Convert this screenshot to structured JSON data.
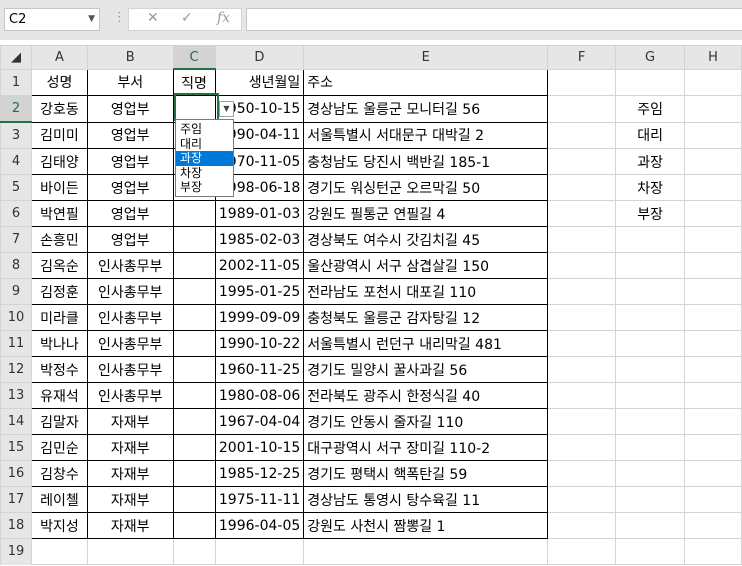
{
  "formula_bar": {
    "name_box": "C2",
    "cancel_icon": "✕",
    "enter_icon": "✓",
    "fx_icon": "fx",
    "formula": ""
  },
  "columns": [
    "A",
    "B",
    "C",
    "D",
    "E",
    "F",
    "G",
    "H"
  ],
  "selected_column": "C",
  "selected_row": 2,
  "rows": [
    {
      "n": "1",
      "a": "성명",
      "b": "부서",
      "c": "직명",
      "d": "생년월일",
      "e": "주소",
      "g": ""
    },
    {
      "n": "2",
      "a": "강호동",
      "b": "영업부",
      "c": "",
      "d": "1950-10-15",
      "e": "경상남도 울릉군 모니터길 56",
      "g": "주임"
    },
    {
      "n": "3",
      "a": "김미미",
      "b": "영업부",
      "c": "",
      "d": "1990-04-11",
      "e": "서울특별시 서대문구 대박길 2",
      "g": "대리"
    },
    {
      "n": "4",
      "a": "김태양",
      "b": "영업부",
      "c": "",
      "d": "1970-11-05",
      "e": "충청남도 당진시 백반길 185-1",
      "g": "과장"
    },
    {
      "n": "5",
      "a": "바이든",
      "b": "영업부",
      "c": "",
      "d": "1998-06-18",
      "e": "경기도 워싱턴군 오르막길 50",
      "g": "차장"
    },
    {
      "n": "6",
      "a": "박연필",
      "b": "영업부",
      "c": "",
      "d": "1989-01-03",
      "e": "강원도 필통군 연필길 4",
      "g": "부장"
    },
    {
      "n": "7",
      "a": "손흥민",
      "b": "영업부",
      "c": "",
      "d": "1985-02-03",
      "e": "경상북도 여수시 갓김치길 45",
      "g": ""
    },
    {
      "n": "8",
      "a": "김옥순",
      "b": "인사총무부",
      "c": "",
      "d": "2002-11-05",
      "e": "울산광역시 서구 삼겹살길 150",
      "g": ""
    },
    {
      "n": "9",
      "a": "김정훈",
      "b": "인사총무부",
      "c": "",
      "d": "1995-01-25",
      "e": "전라남도 포천시 대포길 110",
      "g": ""
    },
    {
      "n": "10",
      "a": "미라클",
      "b": "인사총무부",
      "c": "",
      "d": "1999-09-09",
      "e": "충청북도 울릉군 감자탕길 12",
      "g": ""
    },
    {
      "n": "11",
      "a": "박나나",
      "b": "인사총무부",
      "c": "",
      "d": "1990-10-22",
      "e": "서울특별시 런던구 내리막길 481",
      "g": ""
    },
    {
      "n": "12",
      "a": "박정수",
      "b": "인사총무부",
      "c": "",
      "d": "1960-11-25",
      "e": "경기도 밀양시 꿀사과길 56",
      "g": ""
    },
    {
      "n": "13",
      "a": "유재석",
      "b": "인사총무부",
      "c": "",
      "d": "1980-08-06",
      "e": "전라북도 광주시 한정식길 40",
      "g": ""
    },
    {
      "n": "14",
      "a": "김말자",
      "b": "자재부",
      "c": "",
      "d": "1967-04-04",
      "e": "경기도 안동시 줄자길 110",
      "g": ""
    },
    {
      "n": "15",
      "a": "김민순",
      "b": "자재부",
      "c": "",
      "d": "2001-10-15",
      "e": "대구광역시 서구 장미길 110-2",
      "g": ""
    },
    {
      "n": "16",
      "a": "김창수",
      "b": "자재부",
      "c": "",
      "d": "1985-12-25",
      "e": "경기도 평택시 핵폭탄길 59",
      "g": ""
    },
    {
      "n": "17",
      "a": "레이첼",
      "b": "자재부",
      "c": "",
      "d": "1975-11-11",
      "e": "경상남도 통영시 탕수육길 11",
      "g": ""
    },
    {
      "n": "18",
      "a": "박지성",
      "b": "자재부",
      "c": "",
      "d": "1996-04-05",
      "e": "강원도 사천시 짬뽕길 1",
      "g": ""
    },
    {
      "n": "19",
      "a": "",
      "b": "",
      "c": "",
      "d": "",
      "e": "",
      "g": ""
    }
  ],
  "dropdown": {
    "items": [
      "주임",
      "대리",
      "과장",
      "차장",
      "부장"
    ],
    "highlighted": "과장"
  },
  "colors": {
    "accent": "#217346",
    "highlight": "#0078d7"
  }
}
